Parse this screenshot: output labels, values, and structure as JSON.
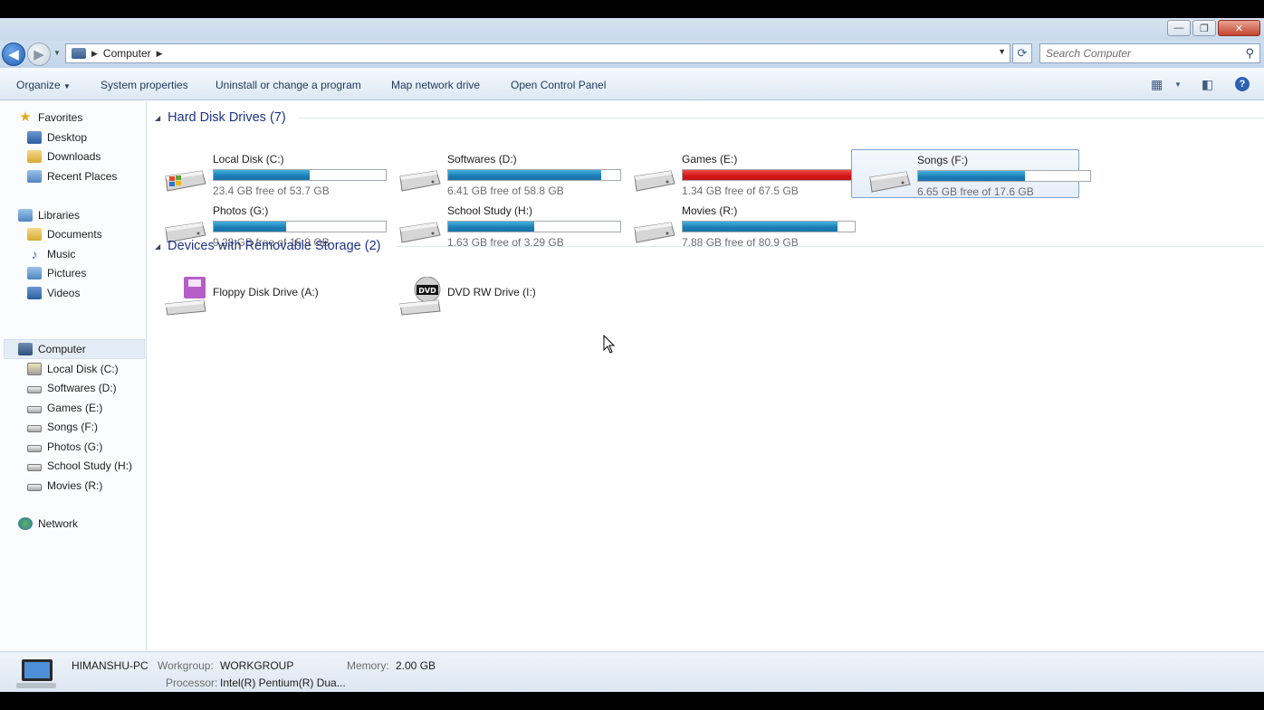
{
  "window": {
    "controls": {
      "minimize": "—",
      "maximize": "❐",
      "close": "✕"
    }
  },
  "address": {
    "crumb": "Computer",
    "search_placeholder": "Search Computer"
  },
  "toolbar": {
    "organize": "Organize",
    "system_properties": "System properties",
    "uninstall": "Uninstall or change a program",
    "map_drive": "Map network drive",
    "control_panel": "Open Control Panel"
  },
  "nav": {
    "favorites": "Favorites",
    "desktop": "Desktop",
    "downloads": "Downloads",
    "recent": "Recent Places",
    "libraries": "Libraries",
    "documents": "Documents",
    "music": "Music",
    "pictures": "Pictures",
    "videos": "Videos",
    "computer": "Computer",
    "drives": [
      "Local Disk (C:)",
      "Softwares (D:)",
      "Games (E:)",
      "Songs (F:)",
      "Photos (G:)",
      "School Study (H:)",
      "Movies (R:)"
    ],
    "network": "Network"
  },
  "groups": {
    "hdd": "Hard Disk Drives (7)",
    "removable": "Devices with Removable Storage (2)"
  },
  "drives": [
    {
      "name": "Local Disk (C:)",
      "free": "23.4 GB free of 53.7 GB",
      "used_fraction": 0.56,
      "full": false
    },
    {
      "name": "Softwares (D:)",
      "free": "6.41 GB free of 58.8 GB",
      "used_fraction": 0.89,
      "full": false
    },
    {
      "name": "Games (E:)",
      "free": "1.34 GB free of 67.5 GB",
      "used_fraction": 0.98,
      "full": true
    },
    {
      "name": "Songs (F:)",
      "free": "6.65 GB free of 17.6 GB",
      "used_fraction": 0.62,
      "full": false
    },
    {
      "name": "Photos (G:)",
      "free": "9.28 GB free of 15.9 GB",
      "used_fraction": 0.42,
      "full": false
    },
    {
      "name": "School Study (H:)",
      "free": "1.63 GB free of 3.29 GB",
      "used_fraction": 0.5,
      "full": false
    },
    {
      "name": "Movies (R:)",
      "free": "7.88 GB free of 80.9 GB",
      "used_fraction": 0.9,
      "full": false
    }
  ],
  "devices": [
    {
      "name": "Floppy Disk Drive (A:)"
    },
    {
      "name": "DVD RW Drive (I:)",
      "badge": "DVD"
    }
  ],
  "details": {
    "pc_name": "HIMANSHU-PC",
    "workgroup_label": "Workgroup:",
    "workgroup": "WORKGROUP",
    "memory_label": "Memory:",
    "memory": "2.00 GB",
    "processor_label": "Processor:",
    "processor": "Intel(R) Pentium(R) Dua..."
  },
  "colors": {
    "bar_normal": "#2793c8",
    "bar_full": "#da1f1f",
    "group_title": "#1e3287"
  }
}
